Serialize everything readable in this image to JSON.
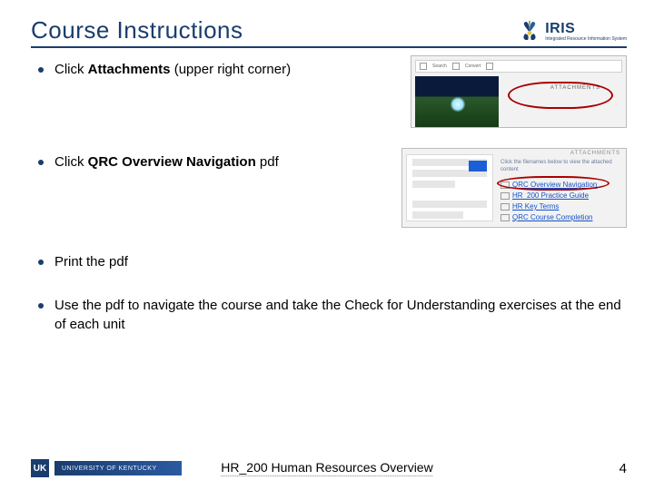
{
  "header": {
    "title": "Course Instructions",
    "logo": {
      "name": "IRIS",
      "sub": "Integrated Resource Information System"
    }
  },
  "bullets": [
    {
      "pre": "Click ",
      "bold": "Attachments",
      "post": " (upper right corner)",
      "thumb": 1
    },
    {
      "pre": "Click ",
      "bold": "QRC Overview Navigation",
      "post": " pdf",
      "thumb": 2
    },
    {
      "pre": "Print the pdf",
      "bold": "",
      "post": ""
    },
    {
      "pre": "Use the pdf to navigate the course and take the Check for Understanding exercises at the end of each unit",
      "bold": "",
      "post": ""
    }
  ],
  "thumb1": {
    "attach_label": "ATTACHMENTS"
  },
  "thumb2": {
    "header": "ATTACHMENTS",
    "info": "Click the filenames below to view the attached content",
    "links": [
      "QRC Overview Navigation",
      "HR_200 Practice Guide",
      "HR Key Terms",
      "QRC Course Completion"
    ]
  },
  "footer": {
    "uk_abbr": "UK",
    "uk_text": "UNIVERSITY OF KENTUCKY",
    "course": "HR_200 Human Resources Overview",
    "page": "4"
  }
}
